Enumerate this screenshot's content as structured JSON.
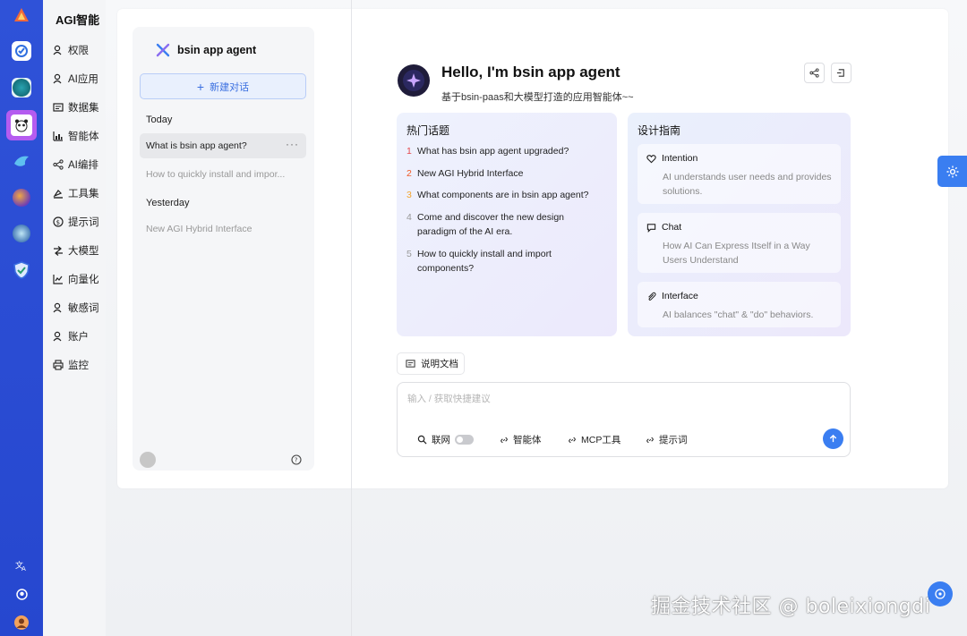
{
  "menu": {
    "brand": "AGI智能",
    "items": [
      {
        "label": "权限",
        "icon": "user-icon"
      },
      {
        "label": "AI应用",
        "icon": "user-icon"
      },
      {
        "label": "数据集",
        "icon": "dataset-icon"
      },
      {
        "label": "智能体",
        "icon": "chart-icon"
      },
      {
        "label": "AI编排",
        "icon": "share-icon"
      },
      {
        "label": "工具集",
        "icon": "tools-icon"
      },
      {
        "label": "提示词",
        "icon": "dollar-icon"
      },
      {
        "label": "大模型",
        "icon": "model-icon"
      },
      {
        "label": "向量化",
        "icon": "vector-icon"
      },
      {
        "label": "敏感词",
        "icon": "user-icon"
      },
      {
        "label": "账户",
        "icon": "user-icon"
      },
      {
        "label": "监控",
        "icon": "printer-icon"
      }
    ]
  },
  "conversations": {
    "agent_name": "bsin app agent",
    "new_button": "新建对话",
    "groups": [
      {
        "label": "Today",
        "items": [
          "What is bsin app agent?",
          "How to quickly install and impor..."
        ]
      },
      {
        "label": "Yesterday",
        "items": [
          "New AGI Hybrid Interface"
        ]
      }
    ],
    "more_label": "···"
  },
  "welcome": {
    "title": "Hello, I'm bsin app agent",
    "subtitle": "基于bsin-paas和大模型打造的应用智能体~~"
  },
  "hot_topics": {
    "title": "热门话题",
    "items": [
      {
        "num": "1",
        "text": "What has bsin app agent upgraded?",
        "color": "#e5484d"
      },
      {
        "num": "2",
        "text": "New AGI Hybrid Interface",
        "color": "#f05a28"
      },
      {
        "num": "3",
        "text": "What components are in bsin app agent?",
        "color": "#f3a530"
      },
      {
        "num": "4",
        "text": "Come and discover the new design paradigm of the AI era.",
        "color": "#999999"
      },
      {
        "num": "5",
        "text": "How to quickly install and import components?",
        "color": "#999999"
      }
    ]
  },
  "design_guide": {
    "title": "设计指南",
    "items": [
      {
        "title": "Intention",
        "desc": "AI understands user needs and provides solutions.",
        "icon": "heart-icon"
      },
      {
        "title": "Chat",
        "desc": "How AI Can Express Itself in a Way Users Understand",
        "icon": "chat-icon"
      },
      {
        "title": "Interface",
        "desc": "AI balances \"chat\" & \"do\" behaviors.",
        "icon": "paperclip-icon"
      }
    ]
  },
  "composer": {
    "doc_tab": "说明文档",
    "placeholder": "输入 / 获取快捷建议",
    "value": "",
    "tools": {
      "web": "联网",
      "agent": "智能体",
      "mcp": "MCP工具",
      "prompt": "提示词"
    }
  },
  "watermark": "掘金技术社区 @ boleixiongdi",
  "colors": {
    "accent": "#3a7ef1",
    "rail": "#2f52d8"
  }
}
